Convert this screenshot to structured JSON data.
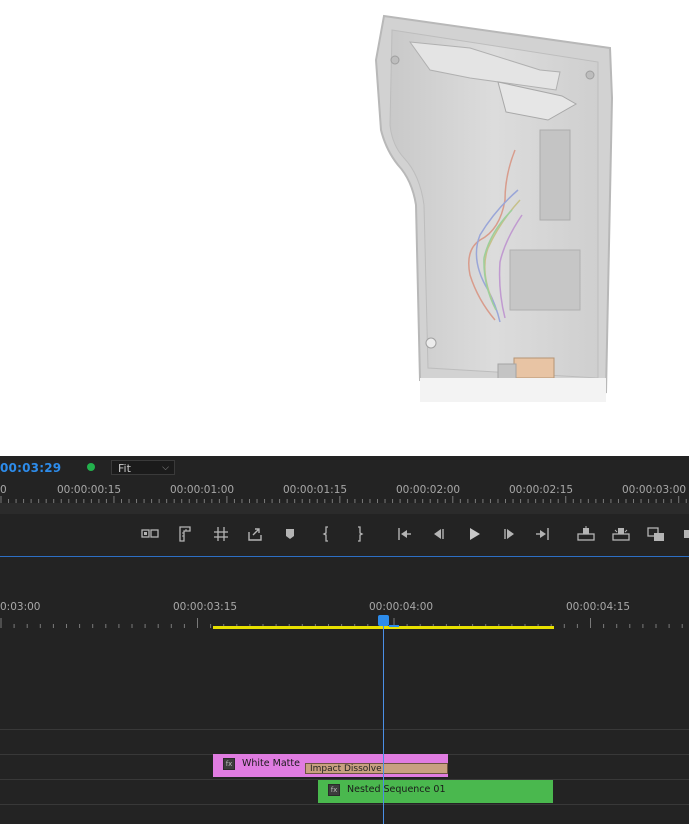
{
  "monitor": {
    "timecode": "00:03:29",
    "zoom_value": "Fit",
    "ruler_labels": [
      "0",
      "00:00:00:15",
      "00:00:01:00",
      "00:00:01:15",
      "00:00:02:00",
      "00:00:02:15",
      "00:00:03:00"
    ]
  },
  "transport": {
    "buttons": [
      "add-marker",
      "go-to-in",
      "go-to-out",
      "mark-in",
      "mark-out",
      "step-back",
      "play",
      "step-forward",
      "go-to-next-edit",
      "lift",
      "extract",
      "export-frame"
    ]
  },
  "timeline": {
    "ruler_labels": [
      "0:03:00",
      "00:00:03:15",
      "00:00:04:00",
      "00:00:04:15"
    ],
    "clips": {
      "white_matte": "White Matte",
      "transition": "Impact Dissolve",
      "nested": "Nested Sequence 01"
    },
    "fx_badge": "fx"
  },
  "colors": {
    "timecode": "#2d8ceb",
    "white_matte_clip": "#e07ce1",
    "nested_clip": "#4ab84e",
    "work_area": "#e8e000",
    "playhead": "#2d8ceb"
  }
}
